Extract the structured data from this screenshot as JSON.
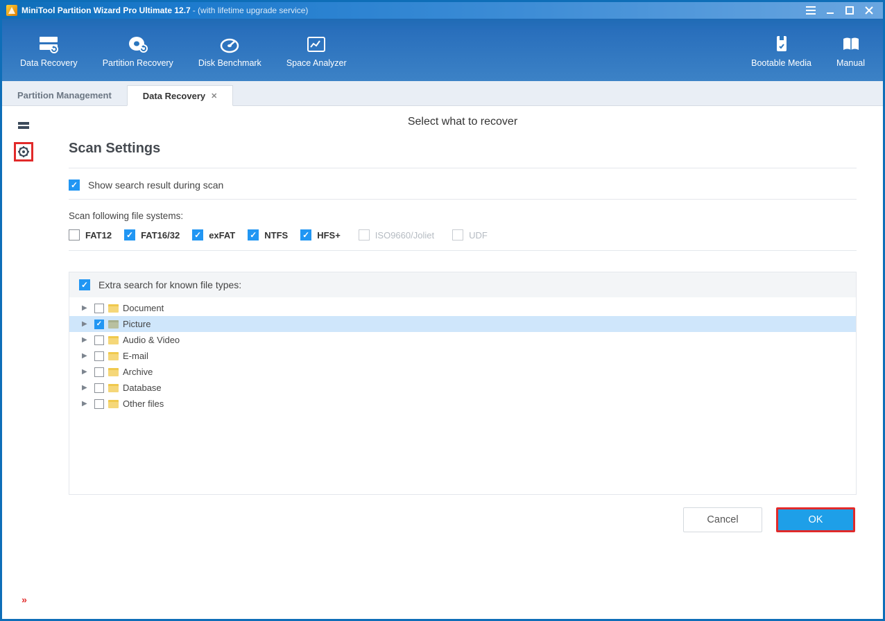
{
  "title": {
    "main": "MiniTool Partition Wizard Pro Ultimate 12.7",
    "sub": " - (with lifetime upgrade service)"
  },
  "ribbon": {
    "left": [
      {
        "label": "Data Recovery"
      },
      {
        "label": "Partition Recovery"
      },
      {
        "label": "Disk Benchmark"
      },
      {
        "label": "Space Analyzer"
      }
    ],
    "right": [
      {
        "label": "Bootable Media"
      },
      {
        "label": "Manual"
      }
    ]
  },
  "tabs": {
    "inactive": "Partition Management",
    "active": "Data Recovery"
  },
  "page": {
    "header": "Select what to recover",
    "section_title": "Scan Settings",
    "show_result_label": "Show search result during scan",
    "fs_label": "Scan following file systems:",
    "fs": [
      {
        "label": "FAT12",
        "checked": false,
        "disabled": false
      },
      {
        "label": "FAT16/32",
        "checked": true,
        "disabled": false
      },
      {
        "label": "exFAT",
        "checked": true,
        "disabled": false
      },
      {
        "label": "NTFS",
        "checked": true,
        "disabled": false
      },
      {
        "label": "HFS+",
        "checked": true,
        "disabled": false
      },
      {
        "label": "ISO9660/Joliet",
        "checked": false,
        "disabled": true
      },
      {
        "label": "UDF",
        "checked": false,
        "disabled": true
      }
    ],
    "extra_label": "Extra search for known file types:",
    "tree": [
      {
        "label": "Document",
        "checked": false,
        "selected": false
      },
      {
        "label": "Picture",
        "checked": true,
        "selected": true
      },
      {
        "label": "Audio & Video",
        "checked": false,
        "selected": false
      },
      {
        "label": "E-mail",
        "checked": false,
        "selected": false
      },
      {
        "label": "Archive",
        "checked": false,
        "selected": false
      },
      {
        "label": "Database",
        "checked": false,
        "selected": false
      },
      {
        "label": "Other files",
        "checked": false,
        "selected": false
      }
    ],
    "buttons": {
      "cancel": "Cancel",
      "ok": "OK"
    }
  }
}
